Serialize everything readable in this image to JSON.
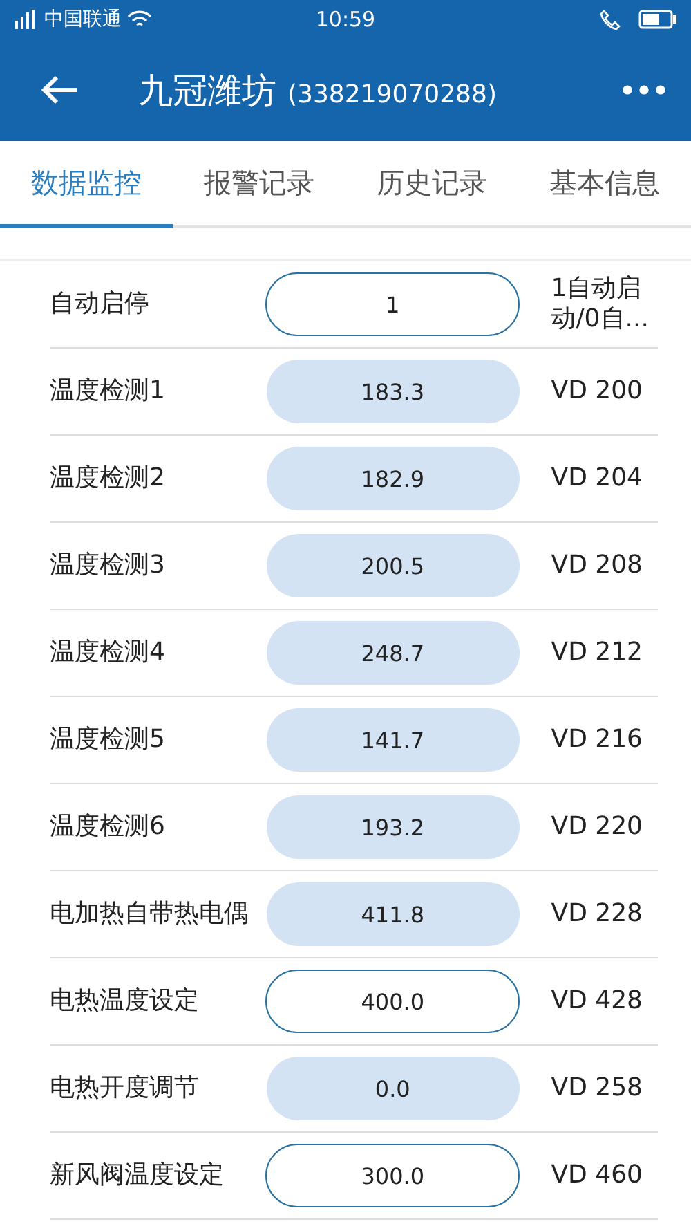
{
  "status_bar": {
    "carrier": "中国联通",
    "time": "10:59"
  },
  "header": {
    "title": "九冠潍坊",
    "subtitle": "(338219070288)"
  },
  "tabs": [
    {
      "label": "数据监控",
      "selected": true
    },
    {
      "label": "报警记录",
      "selected": false
    },
    {
      "label": "历史记录",
      "selected": false
    },
    {
      "label": "基本信息",
      "selected": false
    }
  ],
  "rows": [
    {
      "label": "自动启停",
      "kind": "input",
      "value": "1",
      "note": "1自动启动/0自..."
    },
    {
      "label": "温度检测1",
      "kind": "display",
      "value": "183.3",
      "note": "VD 200"
    },
    {
      "label": "温度检测2",
      "kind": "display",
      "value": "182.9",
      "note": "VD 204"
    },
    {
      "label": "温度检测3",
      "kind": "display",
      "value": "200.5",
      "note": "VD 208"
    },
    {
      "label": "温度检测4",
      "kind": "display",
      "value": "248.7",
      "note": "VD 212"
    },
    {
      "label": "温度检测5",
      "kind": "display",
      "value": "141.7",
      "note": "VD 216"
    },
    {
      "label": "温度检测6",
      "kind": "display",
      "value": "193.2",
      "note": "VD 220"
    },
    {
      "label": "电加热自带热电偶",
      "kind": "display",
      "value": "411.8",
      "note": "VD 228"
    },
    {
      "label": "电热温度设定",
      "kind": "input",
      "value": "400.0",
      "note": "VD 428"
    },
    {
      "label": "电热开度调节",
      "kind": "display",
      "value": "0.0",
      "note": "VD 258"
    },
    {
      "label": "新风阀温度设定",
      "kind": "input",
      "value": "300.0",
      "note": "VD 460"
    }
  ]
}
